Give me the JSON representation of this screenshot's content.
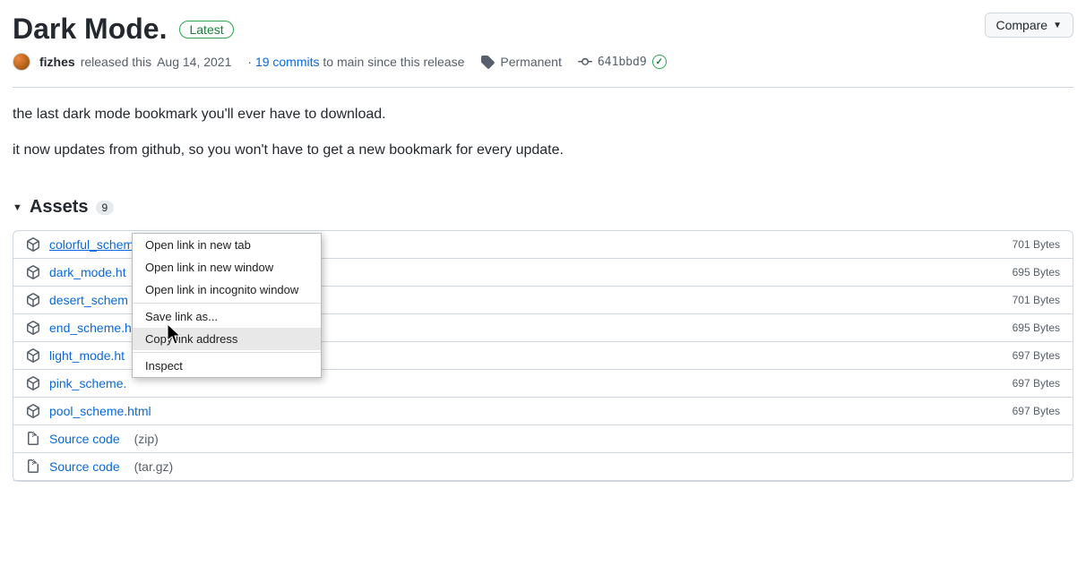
{
  "release": {
    "title": "Dark Mode.",
    "latest_label": "Latest",
    "compare_label": "Compare",
    "author": "fizhes",
    "released_text": "released this",
    "release_date": "Aug 14, 2021",
    "commits_count_text": "19 commits",
    "commits_suffix": " to main since this release",
    "sep_dot": "·",
    "tag_label": "Permanent",
    "commit_hash": "641bbd9",
    "body_line1": "the last dark mode bookmark you'll ever have to download.",
    "body_line2": "it now updates from github, so you won't have to get a new bookmark for every update."
  },
  "assets": {
    "header_label": "Assets",
    "count": "9",
    "items": [
      {
        "name": "colorful_scheme.html",
        "size": "701 Bytes",
        "type": "package"
      },
      {
        "name": "dark_mode.ht",
        "size": "695 Bytes",
        "type": "package"
      },
      {
        "name": "desert_schem",
        "size": "701 Bytes",
        "type": "package"
      },
      {
        "name": "end_scheme.h",
        "size": "695 Bytes",
        "type": "package"
      },
      {
        "name": "light_mode.ht",
        "size": "697 Bytes",
        "type": "package"
      },
      {
        "name": "pink_scheme.",
        "size": "697 Bytes",
        "type": "package"
      },
      {
        "name": "pool_scheme.html",
        "size": "697 Bytes",
        "type": "package"
      },
      {
        "name": "Source code",
        "ext": "(zip)",
        "type": "zip"
      },
      {
        "name": "Source code",
        "ext": "(tar.gz)",
        "type": "zip"
      }
    ]
  },
  "context_menu": {
    "items": [
      {
        "label": "Open link in new tab",
        "highlight": false
      },
      {
        "label": "Open link in new window",
        "highlight": false
      },
      {
        "label": "Open link in incognito window",
        "highlight": false
      },
      {
        "divider": true
      },
      {
        "label": "Save link as...",
        "highlight": false
      },
      {
        "label": "Copy link address",
        "highlight": true
      },
      {
        "divider": true
      },
      {
        "label": "Inspect",
        "highlight": false
      }
    ]
  }
}
